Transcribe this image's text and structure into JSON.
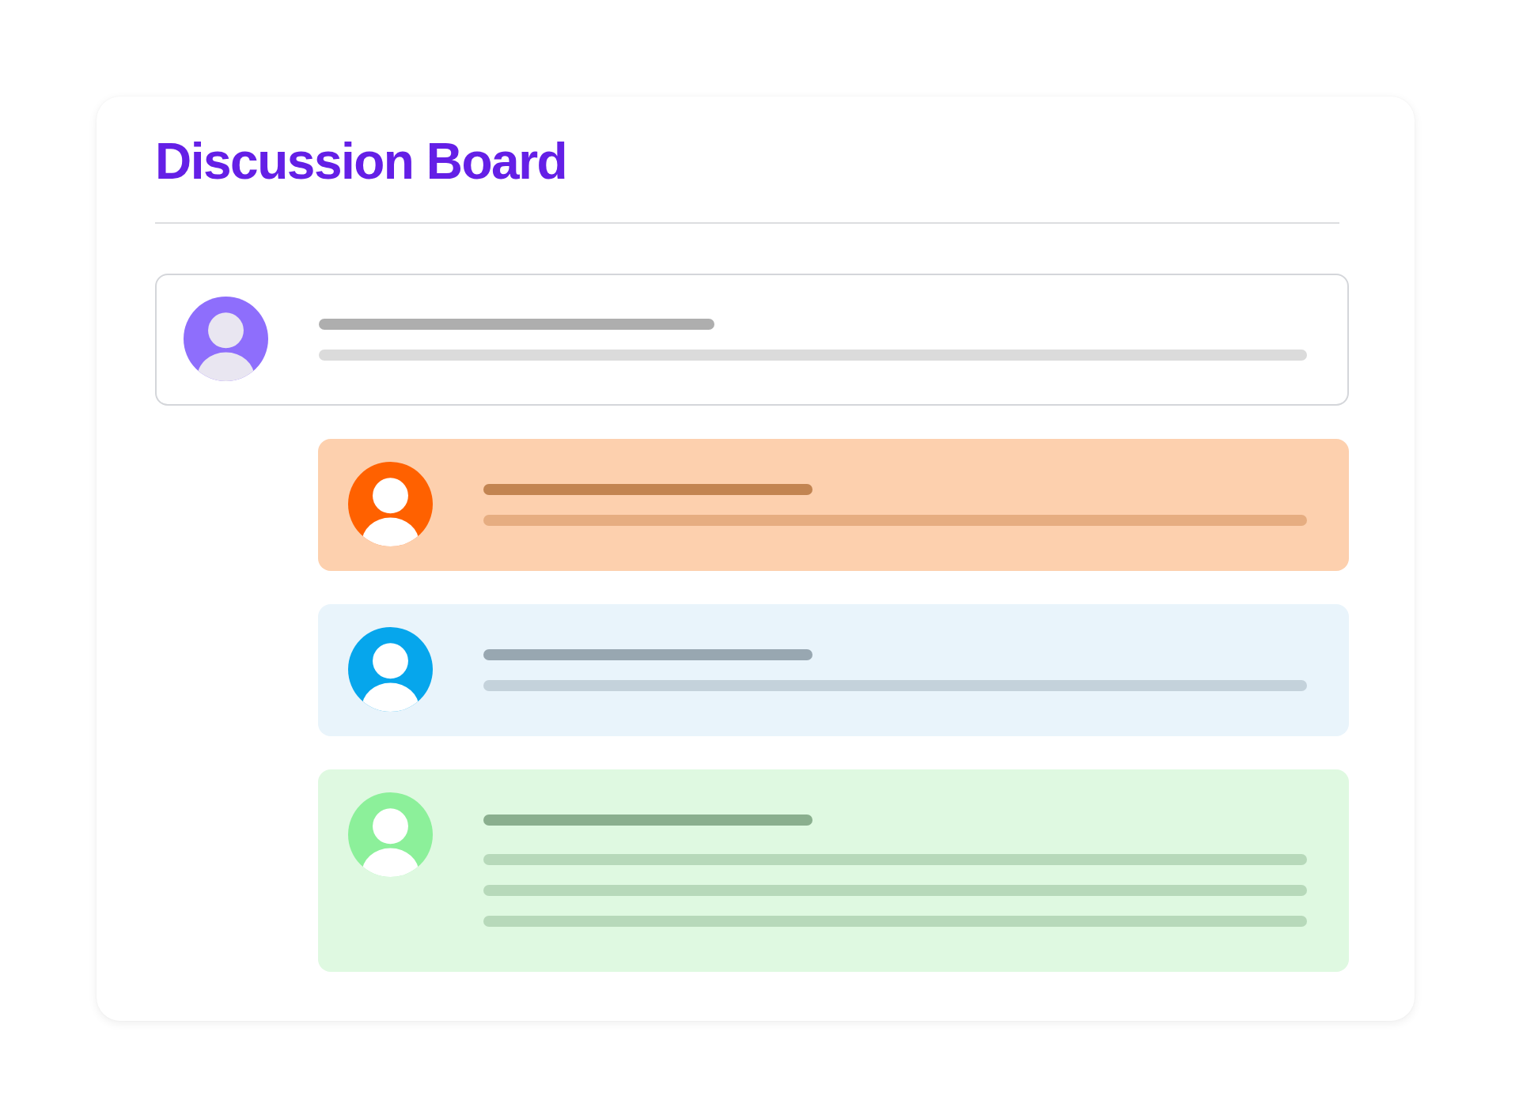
{
  "title": "Discussion Board",
  "posts": [
    {
      "kind": "post",
      "color": "#ffffff",
      "avatar": {
        "color": "#8e6efc"
      },
      "lines": [
        {
          "kind": "heading"
        },
        {
          "kind": "body"
        }
      ]
    },
    {
      "kind": "reply",
      "color": "#fdd0ae",
      "avatar": {
        "color": "#ff6100"
      },
      "lines": [
        {
          "kind": "heading"
        },
        {
          "kind": "body"
        }
      ]
    },
    {
      "kind": "reply",
      "color": "#e9f4fb",
      "avatar": {
        "color": "#06a6ec"
      },
      "lines": [
        {
          "kind": "heading"
        },
        {
          "kind": "body"
        }
      ]
    },
    {
      "kind": "reply",
      "color": "#dff9e1",
      "avatar": {
        "color": "#8cf09a"
      },
      "lines": [
        {
          "kind": "heading"
        },
        {
          "kind": "body"
        },
        {
          "kind": "body"
        },
        {
          "kind": "body"
        }
      ]
    }
  ]
}
